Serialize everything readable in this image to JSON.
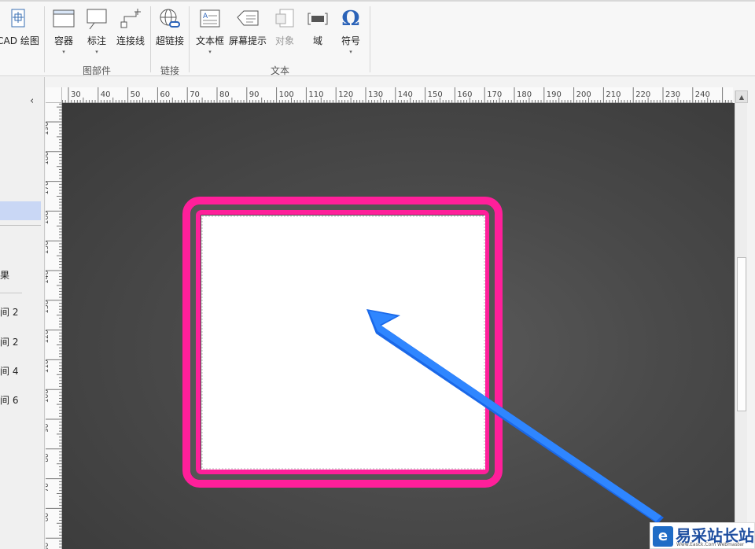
{
  "ribbon": {
    "buttons": [
      {
        "label": "CAD 绘图",
        "icon": "cad-drawing-icon"
      },
      {
        "label": "容器",
        "icon": "container-icon",
        "dropdown": true
      },
      {
        "label": "标注",
        "icon": "callout-icon",
        "dropdown": true
      },
      {
        "label": "连接线",
        "icon": "connector-icon"
      },
      {
        "label": "超链接",
        "icon": "hyperlink-icon"
      },
      {
        "label": "文本框",
        "icon": "textbox-icon",
        "dropdown": true
      },
      {
        "label": "屏幕提示",
        "icon": "screentip-icon"
      },
      {
        "label": "对象",
        "icon": "object-icon",
        "disabled": true
      },
      {
        "label": "域",
        "icon": "field-icon"
      },
      {
        "label": "符号",
        "icon": "symbol-icon",
        "dropdown": true
      }
    ],
    "groups": {
      "diagram_parts": "图部件",
      "links": "链接",
      "text": "文本"
    },
    "dropdown_glyph": "▾",
    "omega_glyph": "Ω"
  },
  "leftpane": {
    "collapse_glyph": "‹",
    "items": [
      "果",
      "间 2",
      "间 2",
      "间 4",
      "间 6"
    ]
  },
  "rulers": {
    "horizontal": [
      "30",
      "40",
      "50",
      "60",
      "70",
      "80",
      "90",
      "100",
      "110",
      "120",
      "130",
      "140",
      "150",
      "160",
      "170",
      "180",
      "190",
      "200",
      "210",
      "220",
      "230",
      "240"
    ],
    "vertical": [
      "190",
      "180",
      "170",
      "160",
      "150",
      "140",
      "130",
      "120",
      "110",
      "100",
      "90",
      "80",
      "70",
      "60",
      "50"
    ]
  },
  "scrollbar": {
    "up_glyph": "▲"
  },
  "watermark": {
    "logo_glyph": "e",
    "title": "易采站长站",
    "subtitle": "Www.Easck.Com Webmaster"
  },
  "colors": {
    "frame_pink": "#ff1f9a",
    "arrow_blue": "#2a7fff",
    "canvas_dark": "#4a4a4a"
  }
}
